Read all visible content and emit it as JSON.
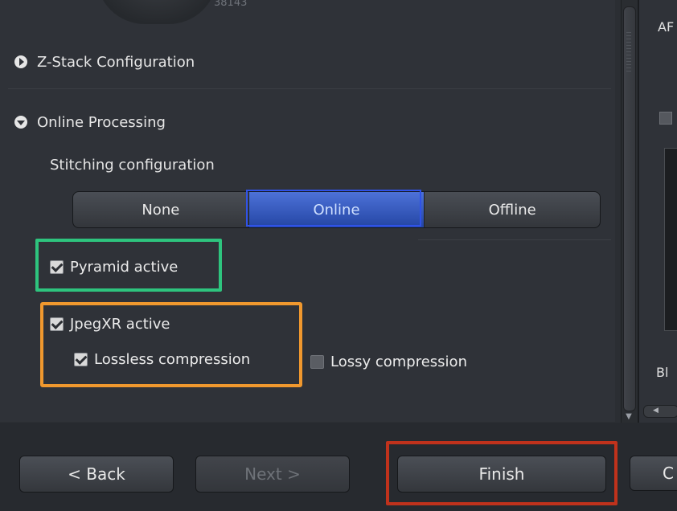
{
  "header": {
    "partial_id": "38143"
  },
  "sections": {
    "zstack_label": "Z-Stack Configuration",
    "online_label": "Online Processing"
  },
  "stitching": {
    "label": "Stitching configuration",
    "options": [
      "None",
      "Online",
      "Offline"
    ],
    "selected": "Online"
  },
  "checkboxes": {
    "pyramid": "Pyramid active",
    "jpegxr": "JpegXR active",
    "lossless": "Lossless compression",
    "lossy": "Lossy compression"
  },
  "right_panel": {
    "top_text": "AF",
    "bottom_text": "Bl"
  },
  "buttons": {
    "back": "< Back",
    "next": "Next >",
    "finish": "Finish",
    "partial": "C"
  },
  "colors": {
    "highlight_blue": "#2f52e8",
    "highlight_green": "#2ec47e",
    "highlight_orange": "#f0982e",
    "highlight_red": "#c0321c"
  }
}
